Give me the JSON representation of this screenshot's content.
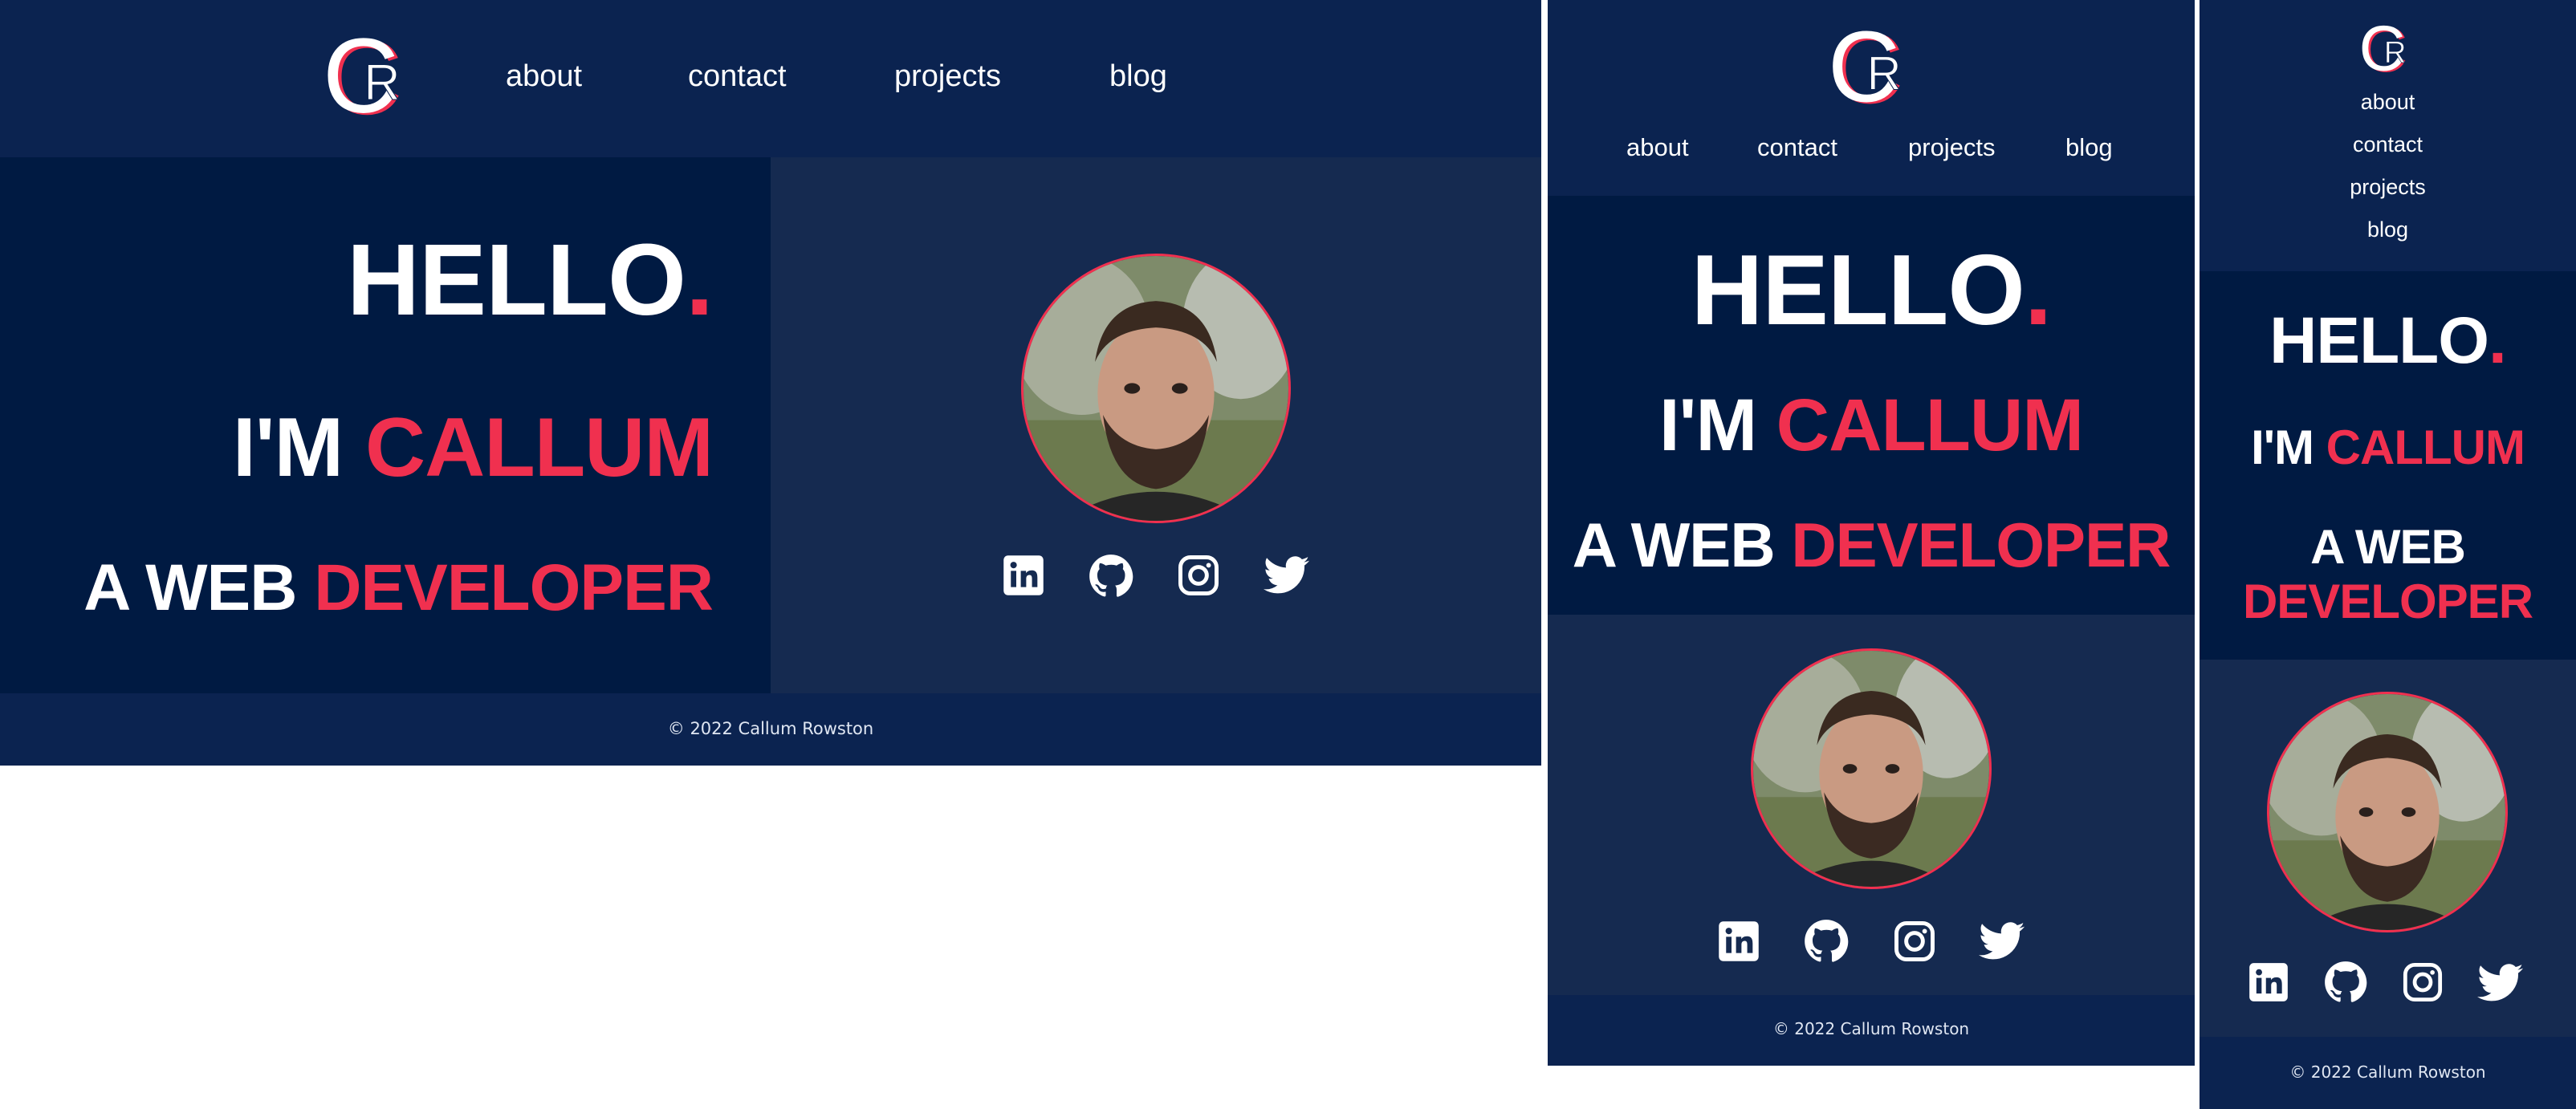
{
  "brand": {
    "logo_letter_back": "C",
    "logo_letter_front": "R"
  },
  "nav": {
    "about": "about",
    "contact": "contact",
    "projects": "projects",
    "blog": "blog"
  },
  "hero": {
    "hello": "HELLO",
    "hello_dot": ".",
    "im": "I'M",
    "name": "CALLUM",
    "a_web": "A WEB",
    "role": "DEVELOPER"
  },
  "social": {
    "icons": [
      "linkedin-icon",
      "github-icon",
      "instagram-icon",
      "twitter-icon"
    ]
  },
  "footer": {
    "copyright": "© 2022 Callum Rowston"
  },
  "colors": {
    "page_bg": "#0b2350",
    "hero_left_bg": "#001a42",
    "hero_right_bg": "#152a50",
    "accent": "#f0304f",
    "text": "#ffffff",
    "outer_bg": "#ffffff"
  }
}
